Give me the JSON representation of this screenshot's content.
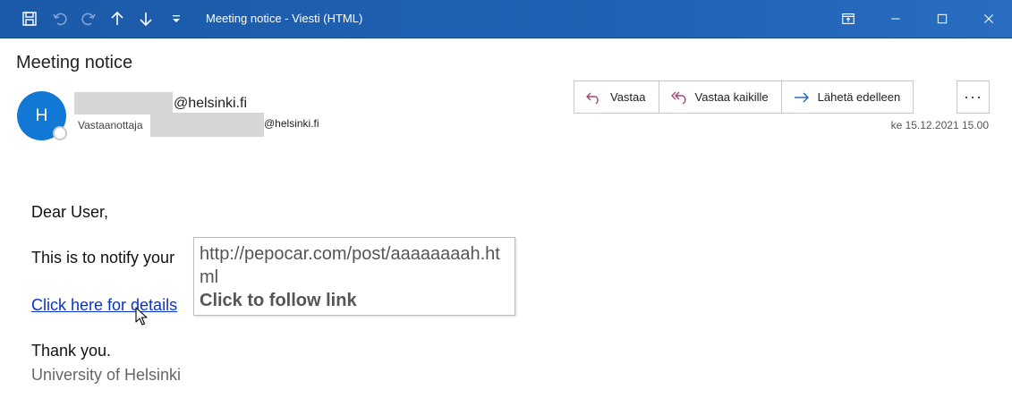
{
  "window": {
    "title": "Meeting notice - Viesti (HTML)"
  },
  "message": {
    "subject": "Meeting notice",
    "avatar_initial": "H",
    "sender_domain": "@helsinki.fi",
    "to_label": "Vastaanottaja",
    "to_domain": "@helsinki.fi",
    "date": "ke 15.12.2021 15.00"
  },
  "actions": {
    "reply": "Vastaa",
    "reply_all": "Vastaa kaikille",
    "forward": "Lähetä edelleen",
    "more": "···"
  },
  "body": {
    "greeting": "Dear User,",
    "notify": "This is to notify your",
    "link_text": "Click here for details",
    "thanks": "Thank you.",
    "signature": "University of Helsinki"
  },
  "tooltip": {
    "url": "http://pepocar.com/post/aaaaaaaah.html",
    "hint": "Click to follow link"
  },
  "colors": {
    "titlebar": "#1f62b5",
    "avatar": "#1178d6",
    "link": "#0a33cc",
    "reply_icon": "#a0467a",
    "forward_icon": "#1f62b5"
  }
}
